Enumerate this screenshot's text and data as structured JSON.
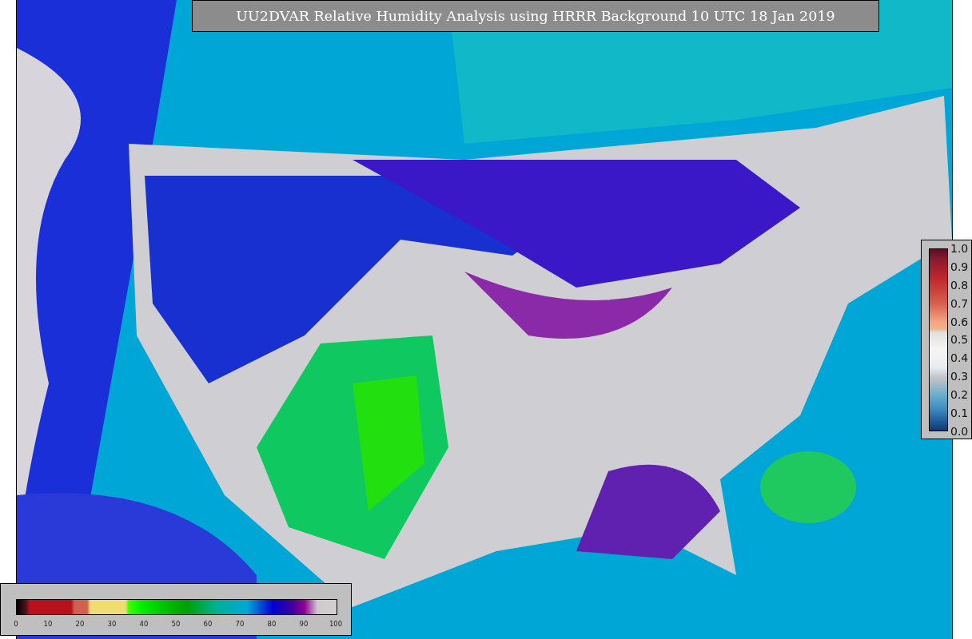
{
  "title": "UU2DVAR Relative Humidity Analysis using HRRR Background 10 UTC 18 Jan 2019",
  "station_colorbar": {
    "ticks": [
      "1.0",
      "0.9",
      "0.8",
      "0.7",
      "0.6",
      "0.5",
      "0.4",
      "0.3",
      "0.2",
      "0.1",
      "0.0"
    ]
  },
  "humidity_colorbar": {
    "ticks": [
      "0",
      "10",
      "20",
      "30",
      "40",
      "50",
      "60",
      "70",
      "80",
      "90",
      "100"
    ]
  }
}
